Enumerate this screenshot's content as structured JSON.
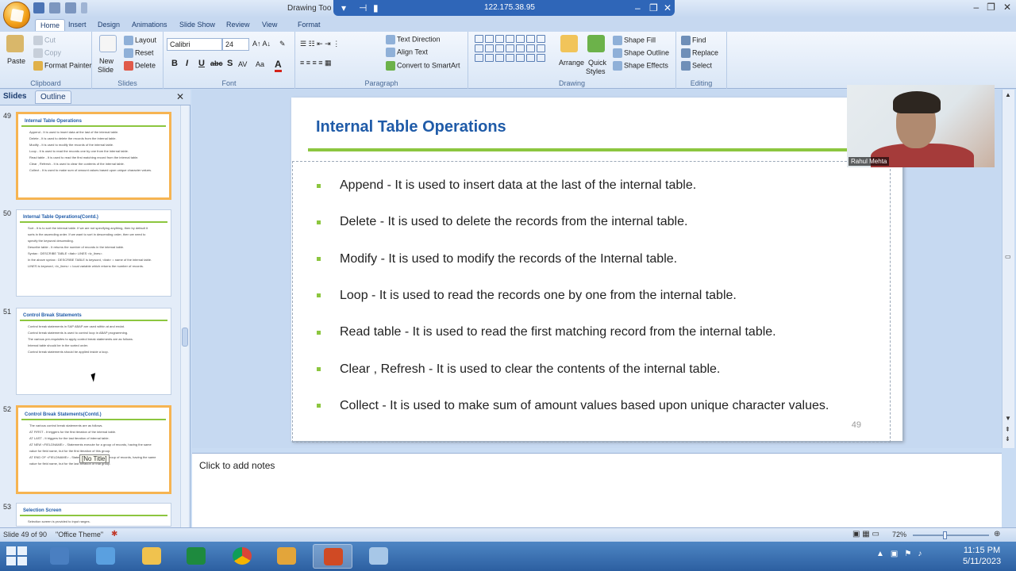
{
  "titlebar": {
    "app_title": "Drawing Too",
    "remote_ip": "122.175.38.95",
    "qat_icons": [
      "save-icon",
      "undo-icon",
      "redo-icon",
      "customize-icon"
    ],
    "window_controls": [
      "minimize-icon",
      "maximize-icon",
      "close-icon"
    ]
  },
  "tabs": [
    "Home",
    "Insert",
    "Design",
    "Animations",
    "Slide Show",
    "Review",
    "View",
    "Format"
  ],
  "ribbon": {
    "clipboard": {
      "paste": "Paste",
      "cut": "Cut",
      "copy": "Copy",
      "format_painter": "Format Painter",
      "label": "Clipboard"
    },
    "slides": {
      "new_slide": "New",
      "new_slide2": "Slide",
      "layout": "Layout",
      "reset": "Reset",
      "delete": "Delete",
      "label": "Slides"
    },
    "font": {
      "family": "Calibri",
      "size": "24",
      "bold": "B",
      "italic": "I",
      "underline": "U",
      "strike": "abc",
      "shadow": "S",
      "label": "Font"
    },
    "paragraph": {
      "text_direction": "Text Direction",
      "align_text": "Align Text",
      "smartart": "Convert to SmartArt",
      "label": "Paragraph"
    },
    "drawing": {
      "arrange": "Arrange",
      "quick_styles": "Quick",
      "quick_styles2": "Styles",
      "shape_fill": "Shape Fill",
      "shape_outline": "Shape Outline",
      "shape_effects": "Shape Effects",
      "label": "Drawing"
    },
    "editing": {
      "find": "Find",
      "replace": "Replace",
      "select": "Select",
      "label": "Editing"
    }
  },
  "panel": {
    "tab_slides": "Slides",
    "tab_outline": "Outline",
    "thumbs": [
      {
        "num": "49",
        "title": "Internal Table Operations",
        "lines": [
          "Append - It is used to insert data at the last of the internal table.",
          "Delete - It is used to delete the records from the internal table.",
          "Modify - It is used to modify the records of the internal table.",
          "Loop - It is used to read the records one by one from the internal table.",
          "Read table - It is used to read the first matching record from the internal table.",
          "Clear , Refresh - It is used to clear the contents of the internal table.",
          "Collect - It is used to make sum of amount values based upon unique character values."
        ]
      },
      {
        "num": "50",
        "title": "Internal Table Operations(Contd.)",
        "lines": [
          "Sort - It is to sort the internal table. If we are not specifying anything, then by default it",
          "sorts in the ascending order. If we want to sort in descending order, then we need to",
          "specify the keyword descending.",
          "Describe table - It returns the number of records in the internal table.",
          "Syntax : DESCRIBE TABLE <itab> LINES <lv_lines>.",
          "In the above syntax : DESCRIBE TABLE is keyword, <itab> = name of the internal table.",
          "LINES is keyword, <lv_lines> = local variable which returns the number of records."
        ]
      },
      {
        "num": "51",
        "title": "Control Break Statements",
        "lines": [
          "Control break statements in SAP ABAP are used within at and endat.",
          "Control break statements is used to control loop in ABAP programming.",
          "The various pre-requisites to apply control break statements are as follows.",
          "Internal table should be in the sorted order.",
          "Control break statements should be applied inside a loop."
        ]
      },
      {
        "num": "52",
        "title": "Control Break Statements(Contd.)",
        "lines": [
          "The various control break statements are as follows.",
          "AT FIRST - It triggers for the first iteration of the internal table.",
          "AT LAST - It triggers for the last iteration of internal table.",
          "AT NEW <FIELDNAME> - Statements execute for a group of records, having the same",
          "value for field name, but for the first iteration of this group.",
          "AT END OF <FIELDNAME> - Statements execute for a group of records, having the same",
          "value for field name, but for the last iteration of that group."
        ]
      },
      {
        "num": "53",
        "title": "Selection Screen",
        "lines": [
          "Selection screen is provided to input ranges."
        ]
      }
    ],
    "tooltip": "[No Title]"
  },
  "slide": {
    "title": "Internal Table Operations",
    "bullets": [
      "Append - It is used to insert data at the last of the internal table.",
      "Delete - It is used to delete the records from the internal table.",
      "Modify - It is used to modify the records of the Internal table.",
      "Loop - It is used to read the records one by one from the internal table.",
      "Read table - It is used to read the first matching record from the internal table.",
      "Clear , Refresh - It is used to clear the contents of the internal table.",
      "Collect - It is used to make sum of amount values based upon unique character values."
    ],
    "page_number": "49",
    "accent": "#8cc63f",
    "title_color": "#1f5ba8"
  },
  "webcam": {
    "name": "Rahul Mehta"
  },
  "notes": {
    "placeholder": "Click to add notes"
  },
  "status": {
    "slide": "Slide 49 of 90",
    "theme": "\"Office Theme\"",
    "zoom": "72%"
  },
  "taskbar": {
    "apps": [
      "windows-explorer",
      "remote-desktop",
      "file-explorer",
      "excel",
      "chrome",
      "vpn",
      "powerpoint",
      "notepad"
    ],
    "time": "11:15 PM",
    "date": "5/11/2023"
  }
}
